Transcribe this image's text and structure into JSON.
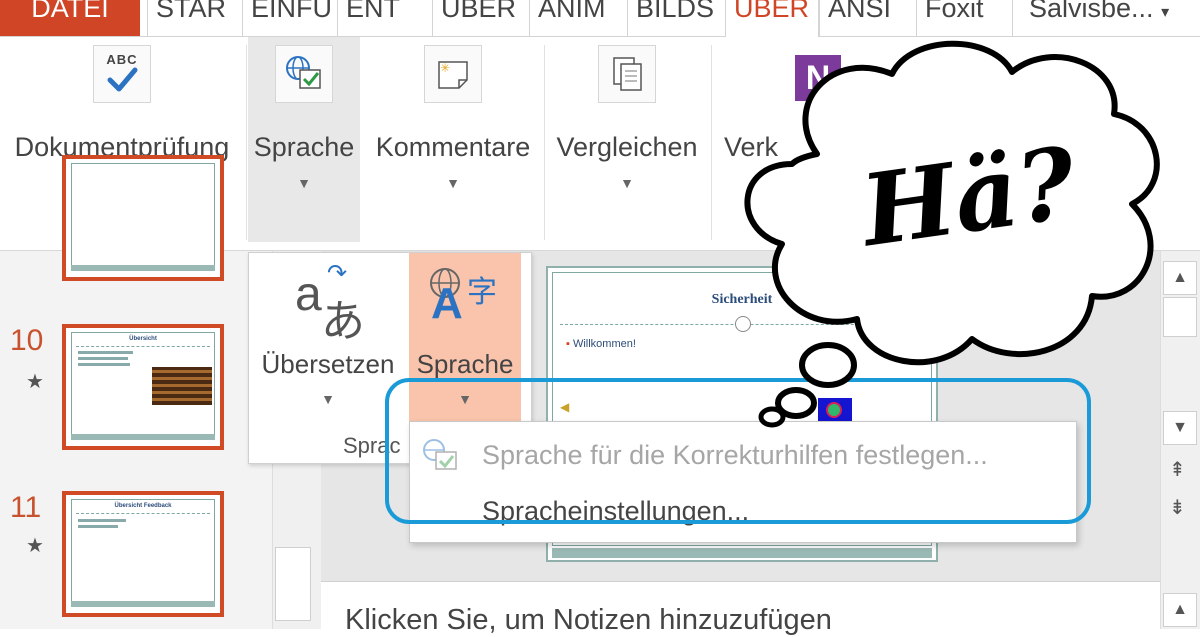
{
  "tabs": [
    {
      "label": "DATEI"
    },
    {
      "label": "STAR"
    },
    {
      "label": "EINFÜ"
    },
    {
      "label": "ENT"
    },
    {
      "label": "ÜBER"
    },
    {
      "label": "ANIM"
    },
    {
      "label": "BILDS"
    },
    {
      "label": "ÜBER"
    },
    {
      "label": "ANSI"
    },
    {
      "label": "Foxit"
    }
  ],
  "user_name": "Salvisbe...",
  "ribbon": {
    "buttons": [
      {
        "label": "Dokumentprüfung",
        "icon": "spellcheck-abc-icon"
      },
      {
        "label": "Sprache",
        "icon": "language-globe-icon"
      },
      {
        "label": "Kommentare",
        "icon": "comment-icon"
      },
      {
        "label": "Vergleichen",
        "icon": "compare-icon"
      },
      {
        "label": "Verk",
        "icon": "onenote-icon"
      }
    ],
    "abc_text": "ABC",
    "onenote_letter": "N"
  },
  "language_panel": {
    "translate_label": "Übersetzen",
    "language_label": "Sprache",
    "group_label": "Sprac",
    "translate_glyph_a": "a",
    "translate_glyph_jp": "あ",
    "language_glyph_a": "A",
    "language_glyph_cjk": "字"
  },
  "menu": {
    "items": [
      {
        "label": "Sprache für die Korrekturhilfen festlegen...",
        "enabled": false
      },
      {
        "label": "Spracheinstellungen...",
        "enabled": true
      }
    ]
  },
  "slides": [
    {
      "number": "10",
      "title": "Übersicht"
    },
    {
      "number": "11",
      "title": "Übersicht Feedback"
    }
  ],
  "current_slide": {
    "title": "Sicherheit",
    "bullet": "Willkommen!"
  },
  "notes_placeholder": "Klicken Sie, um Notizen hinzuzufügen",
  "bubble_text": "Hä?",
  "colors": {
    "accent": "#d04525",
    "highlight_outline": "#1a9bd8",
    "pressed_button": "#f9c4ab"
  }
}
